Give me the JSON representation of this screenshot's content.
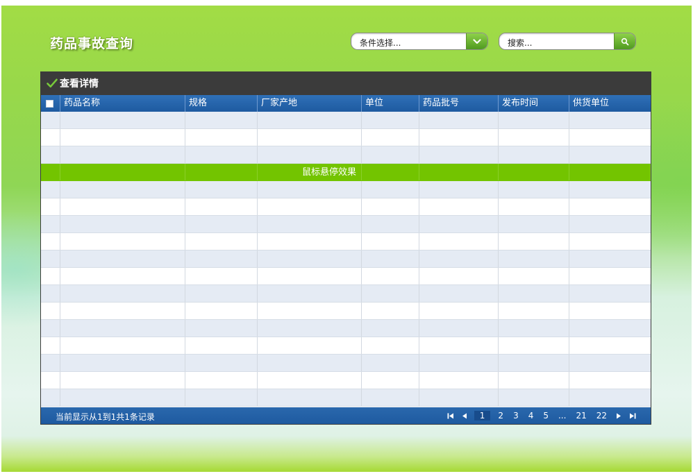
{
  "header": {
    "title": "药品事故查询",
    "condition_placeholder": "条件选择...",
    "search_placeholder": "搜索..."
  },
  "panel": {
    "title": "查看详情",
    "columns": [
      "药品名称",
      "规格",
      "厂家产地",
      "单位",
      "药品批号",
      "发布时间",
      "供货单位"
    ],
    "hover_text": "鼠标悬停效果"
  },
  "footer": {
    "info": "当前显示从1到1共1条记录",
    "pages": [
      "1",
      "2",
      "3",
      "4",
      "5",
      "...",
      "21",
      "22"
    ],
    "current_page": "1"
  },
  "colors": {
    "header_blue": "#2065ad",
    "hover_green": "#73c400",
    "row_alt": "#e5ebf4"
  }
}
